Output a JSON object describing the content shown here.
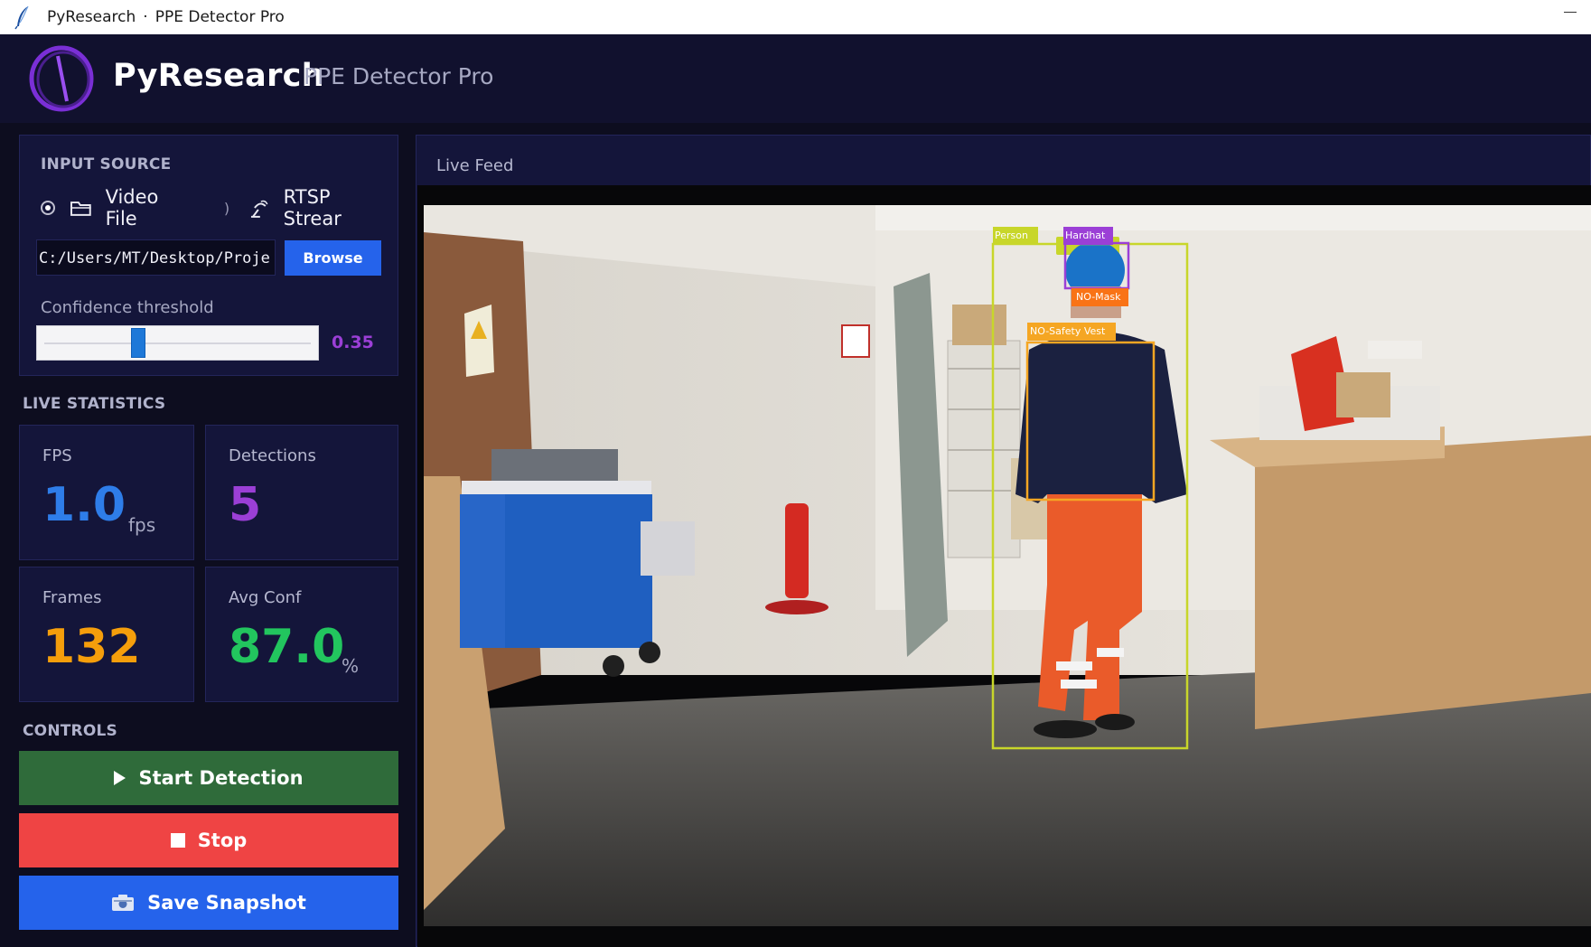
{
  "window": {
    "title_app": "PyResearch",
    "title_separator": "·",
    "title_name": "PPE Detector Pro",
    "minimize_label": "—"
  },
  "header": {
    "brand": "PyResearch",
    "subtitle": "PPE Detector Pro"
  },
  "input_source": {
    "section_label": "INPUT SOURCE",
    "options": [
      {
        "label": "Video File",
        "icon": "folder-icon",
        "selected": true
      },
      {
        "label": "RTSP Strear",
        "icon": "satellite-icon",
        "selected": false
      }
    ],
    "path_value": "C:/Users/MT/Desktop/Proje",
    "browse_label": "Browse",
    "confidence_label": "Confidence threshold",
    "confidence_value": "0.35",
    "confidence_fraction": 0.35
  },
  "stats": {
    "section_label": "LIVE STATISTICS",
    "fps": {
      "title": "FPS",
      "value": "1.0",
      "unit": "fps",
      "color": "#2e7de9"
    },
    "detections": {
      "title": "Detections",
      "value": "5",
      "color": "#9b3fd6"
    },
    "frames": {
      "title": "Frames",
      "value": "132",
      "color": "#f59e0b"
    },
    "avg_conf": {
      "title": "Avg Conf",
      "value": "87.0",
      "unit": "%",
      "color": "#22c55e"
    }
  },
  "controls": {
    "section_label": "CONTROLS",
    "start_label": "Start Detection",
    "stop_label": "Stop",
    "snapshot_label": "Save Snapshot",
    "colors": {
      "start": "#2f6b3a",
      "stop": "#ef4444",
      "snapshot": "#2563eb"
    }
  },
  "feed": {
    "label": "Live Feed",
    "detections": [
      {
        "label": "Person",
        "color": "#c8d62a"
      },
      {
        "label": "Hardhat",
        "color": "#9b3fd6"
      },
      {
        "label": "NO-Mask",
        "color": "#f97316"
      },
      {
        "label": "NO-Safety Vest",
        "color": "#f5a623"
      }
    ]
  }
}
